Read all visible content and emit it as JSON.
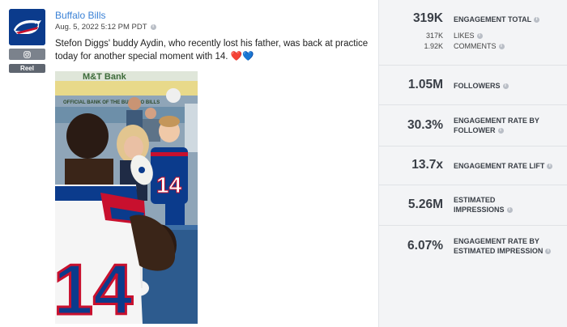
{
  "post": {
    "account_name": "Buffalo Bills",
    "date": "Aug. 5, 2022 5:12 PM PDT",
    "caption": "Stefon Diggs' buddy Aydin, who recently lost his father, was back at practice today for another special moment with 14. ❤️💙",
    "badge": "Reel",
    "platform_icon": "instagram-icon",
    "photo_signage": {
      "top": "M&T Bank",
      "banner": "OFFICIAL BANK OF THE BUFFALO BILLS",
      "jersey_number": "14"
    }
  },
  "metrics": {
    "engagement_total": {
      "value": "319K",
      "label": "ENGAGEMENT TOTAL"
    },
    "likes": {
      "value": "317K",
      "label": "LIKES"
    },
    "comments": {
      "value": "1.92K",
      "label": "COMMENTS"
    },
    "followers": {
      "value": "1.05M",
      "label": "FOLLOWERS"
    },
    "engagement_rate_follower": {
      "value": "30.3%",
      "label_line1": "ENGAGEMENT RATE BY",
      "label_line2": "FOLLOWER"
    },
    "engagement_rate_lift": {
      "value": "13.7x",
      "label": "ENGAGEMENT RATE LIFT"
    },
    "estimated_impressions": {
      "value": "5.26M",
      "label_line1": "ESTIMATED",
      "label_line2": "IMPRESSIONS"
    },
    "engagement_rate_impression": {
      "value": "6.07%",
      "label_line1": "ENGAGEMENT RATE BY",
      "label_line2": "ESTIMATED IMPRESSION"
    }
  },
  "colors": {
    "accent": "#3b82d6",
    "bills_blue": "#0b3b8c",
    "bills_red": "#c8102e",
    "panel_bg": "#f3f4f6"
  }
}
